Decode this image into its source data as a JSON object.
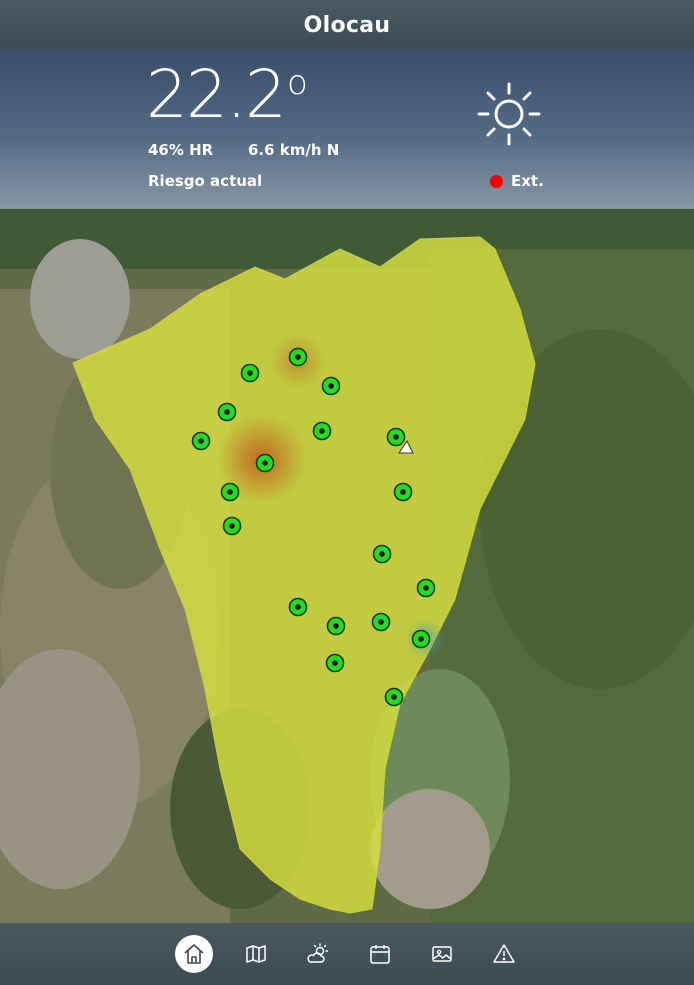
{
  "header": {
    "title": "Olocau"
  },
  "weather": {
    "temperature": "22.2",
    "degree_symbol": "o",
    "humidity": "46% HR",
    "wind": "6.6 km/h N",
    "risk_label": "Riesgo actual",
    "risk_level": "Ext.",
    "risk_color": "#ff0000",
    "condition_icon": "sun-icon"
  },
  "map": {
    "base_layer": "satellite",
    "overlay_color": "#d8e040",
    "marker_color": "#22dd22",
    "marker_count": 19,
    "has_location_arrow": true
  },
  "nav": {
    "items": [
      {
        "name": "home",
        "icon": "home-icon",
        "active": true
      },
      {
        "name": "map",
        "icon": "map-icon",
        "active": false
      },
      {
        "name": "forecast",
        "icon": "sun-cloud-icon",
        "active": false
      },
      {
        "name": "calendar",
        "icon": "calendar-icon",
        "active": false
      },
      {
        "name": "gallery",
        "icon": "image-icon",
        "active": false
      },
      {
        "name": "alerts",
        "icon": "warning-icon",
        "active": false
      }
    ]
  }
}
